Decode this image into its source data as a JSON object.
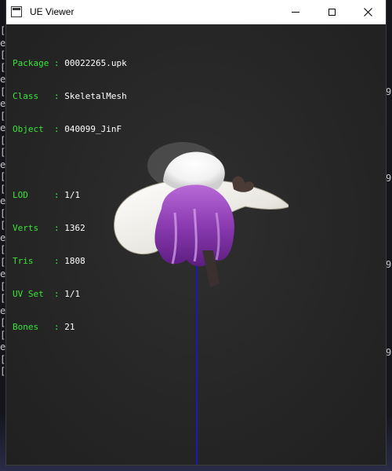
{
  "window": {
    "title": "UE Viewer",
    "icon": "app-window-icon"
  },
  "controls": {
    "minimize_icon": "minimize-icon",
    "maximize_icon": "maximize-icon",
    "close_icon": "close-icon",
    "close_glyph": "✕"
  },
  "info": {
    "package": {
      "key": "Package",
      "value": "00022265.upk"
    },
    "class": {
      "key": "Class  ",
      "value": "SkeletalMesh"
    },
    "object": {
      "key": "Object ",
      "value": "040099_JinF"
    },
    "lod": {
      "key": "LOD    ",
      "value": "1/1"
    },
    "verts": {
      "key": "Verts  ",
      "value": "1362"
    },
    "tris": {
      "key": "Tris   ",
      "value": "1808"
    },
    "uvset": {
      "key": "UV Set ",
      "value": "1/1"
    },
    "bones": {
      "key": "Bones  ",
      "value": "21"
    },
    "separator": " : "
  },
  "background": {
    "right_gutter_glyphs": [
      "9",
      "9",
      "9",
      "9"
    ]
  }
}
